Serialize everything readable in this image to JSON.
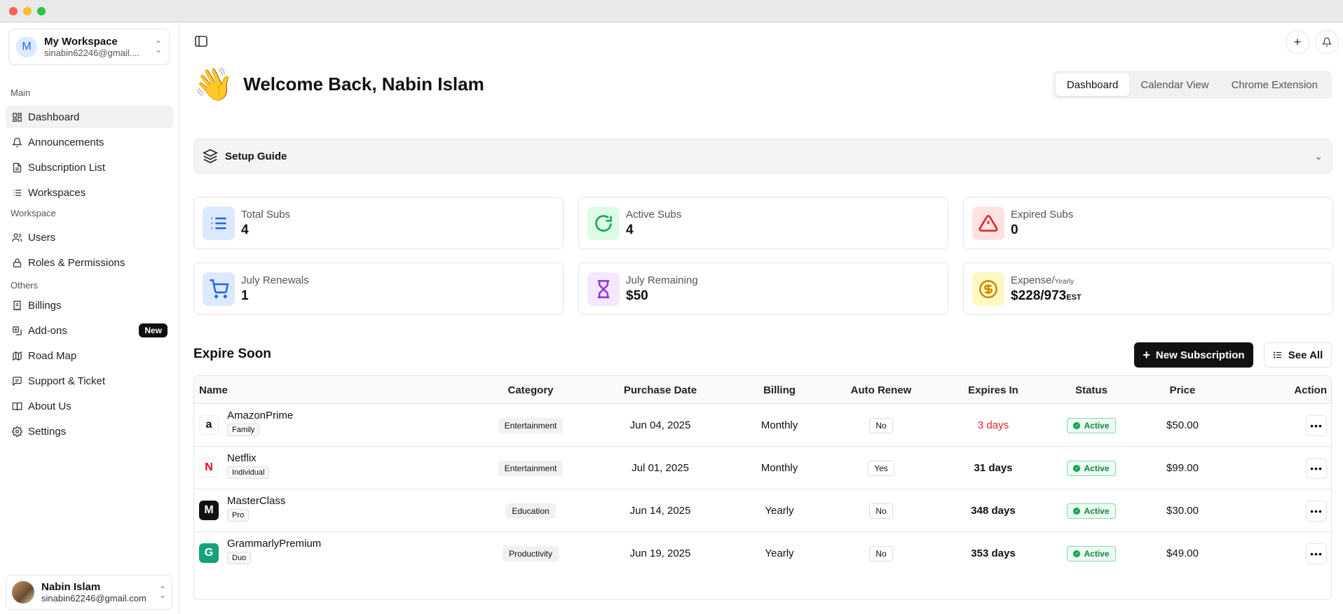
{
  "window": {
    "controls": [
      "close",
      "minimize",
      "maximize"
    ]
  },
  "workspace": {
    "avatar_letter": "M",
    "name": "My Workspace",
    "email": "sinabin62246@gmail...."
  },
  "sidebar": {
    "sections": {
      "main": "Main",
      "workspace": "Workspace",
      "others": "Others"
    },
    "items": [
      {
        "label": "Dashboard",
        "icon": "dashboard-icon",
        "active": true
      },
      {
        "label": "Announcements",
        "icon": "bell-ring-icon"
      },
      {
        "label": "Subscription List",
        "icon": "file-icon"
      },
      {
        "label": "Workspaces",
        "icon": "list-icon"
      },
      {
        "label": "Users",
        "icon": "users-icon"
      },
      {
        "label": "Roles & Permissions",
        "icon": "lock-icon"
      },
      {
        "label": "Billings",
        "icon": "receipt-icon"
      },
      {
        "label": "Add-ons",
        "icon": "addons-icon",
        "badge": "New"
      },
      {
        "label": "Road Map",
        "icon": "map-icon"
      },
      {
        "label": "Support & Ticket",
        "icon": "message-icon"
      },
      {
        "label": "About Us",
        "icon": "book-icon"
      },
      {
        "label": "Settings",
        "icon": "gear-icon"
      }
    ]
  },
  "user": {
    "name": "Nabin Islam",
    "email": "sinabin62246@gmail.com"
  },
  "header": {
    "wave_emoji": "👋",
    "welcome": "Welcome Back, Nabin Islam",
    "tabs": [
      "Dashboard",
      "Calendar View",
      "Chrome Extension"
    ],
    "active_tab": "Dashboard"
  },
  "setup_guide": {
    "title": "Setup Guide"
  },
  "stats": [
    {
      "label": "Total Subs",
      "value": "4",
      "icon": "list-icon",
      "color": "#2563eb",
      "bg": "#dbeafe"
    },
    {
      "label": "Active Subs",
      "value": "4",
      "icon": "refresh-icon",
      "color": "#16a34a",
      "bg": "#dcfce7"
    },
    {
      "label": "Expired Subs",
      "value": "0",
      "icon": "warning-icon",
      "color": "#dc2626",
      "bg": "#fee2e2"
    },
    {
      "label": "July Renewals",
      "value": "1",
      "icon": "cart-icon",
      "color": "#2563eb",
      "bg": "#dbeafe"
    },
    {
      "label": "July Remaining",
      "value": "$50",
      "icon": "hourglass-icon",
      "color": "#9333ea",
      "bg": "#f3e8ff"
    },
    {
      "label": "Expense/",
      "label_suffix": "Yearly",
      "value": "$228/973",
      "value_suffix": "EST",
      "icon": "dollar-icon",
      "color": "#ca8a04",
      "bg": "#fef9c3"
    }
  ],
  "expire_soon": {
    "title": "Expire Soon",
    "new_button": "New Subscription",
    "see_all_button": "See All",
    "columns": [
      "Name",
      "Category",
      "Purchase Date",
      "Billing",
      "Auto Renew",
      "Expires In",
      "Status",
      "Price",
      "Action"
    ],
    "rows": [
      {
        "name": "AmazonPrime",
        "plan": "Family",
        "category": "Entertainment",
        "purchase_date": "Jun 04, 2025",
        "billing": "Monthly",
        "auto_renew": "No",
        "expires_in": "3 days",
        "urgent": true,
        "status": "Active",
        "price": "$50.00",
        "logo": "a",
        "logo_color": "#111",
        "logo_bg": "#fff"
      },
      {
        "name": "Netflix",
        "plan": "Individual",
        "category": "Entertainment",
        "purchase_date": "Jul 01, 2025",
        "billing": "Monthly",
        "auto_renew": "Yes",
        "expires_in": "31 days",
        "urgent": false,
        "status": "Active",
        "price": "$99.00",
        "logo": "N",
        "logo_color": "#e50914",
        "logo_bg": "#fff"
      },
      {
        "name": "MasterClass",
        "plan": "Pro",
        "category": "Education",
        "purchase_date": "Jun 14, 2025",
        "billing": "Yearly",
        "auto_renew": "No",
        "expires_in": "348 days",
        "urgent": false,
        "status": "Active",
        "price": "$30.00",
        "logo": "M",
        "logo_color": "#fff",
        "logo_bg": "#111"
      },
      {
        "name": "GrammarlyPremium",
        "plan": "Duo",
        "category": "Productivity",
        "purchase_date": "Jun 19, 2025",
        "billing": "Yearly",
        "auto_renew": "No",
        "expires_in": "353 days",
        "urgent": false,
        "status": "Active",
        "price": "$49.00",
        "logo": "G",
        "logo_color": "#fff",
        "logo_bg": "#15a17a"
      }
    ]
  },
  "colors": {
    "urgent": "#dc2626",
    "accent": "#111111"
  }
}
